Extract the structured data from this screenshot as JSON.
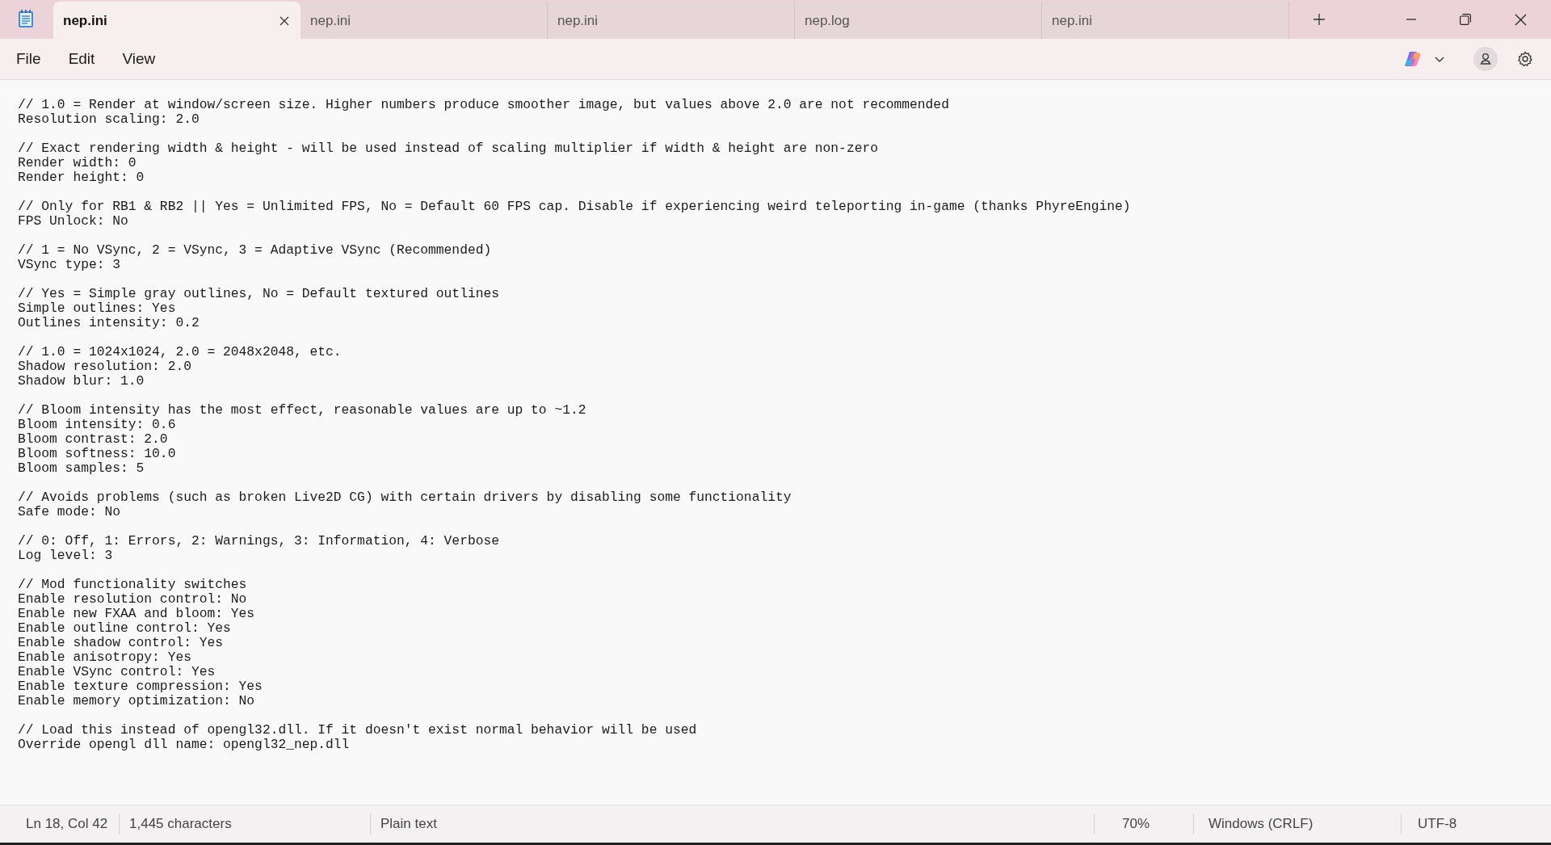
{
  "tabs": [
    {
      "label": "nep.ini",
      "selected": true
    },
    {
      "label": "nep.ini",
      "selected": false
    },
    {
      "label": "nep.ini",
      "selected": false
    },
    {
      "label": "nep.log",
      "selected": false
    },
    {
      "label": "nep.ini",
      "selected": false
    }
  ],
  "menu": [
    "File",
    "Edit",
    "View"
  ],
  "editor": {
    "blocks": [
      [
        "// 1.0 = Render at window/screen size. Higher numbers produce smoother image, but values above 2.0 are not recommended",
        "Resolution scaling: 2.0"
      ],
      [
        "// Exact rendering width & height - will be used instead of scaling multiplier if width & height are non-zero",
        "Render width: 0",
        "Render height: 0"
      ],
      [
        "// Only for RB1 & RB2 || Yes = Unlimited FPS, No = Default 60 FPS cap. Disable if experiencing weird teleporting in-game (thanks PhyreEngine)",
        "FPS Unlock: No"
      ],
      [
        "// 1 = No VSync, 2 = VSync, 3 = Adaptive VSync (Recommended)",
        "VSync type: 3"
      ],
      [
        "// Yes = Simple gray outlines, No = Default textured outlines",
        "Simple outlines: Yes",
        "Outlines intensity: 0.2"
      ],
      [
        "// 1.0 = 1024x1024, 2.0 = 2048x2048, etc.",
        "Shadow resolution: 2.0",
        "Shadow blur: 1.0"
      ],
      [
        "// Bloom intensity has the most effect, reasonable values are up to ~1.2",
        "Bloom intensity: 0.6",
        "Bloom contrast: 2.0",
        "Bloom softness: 10.0",
        "Bloom samples: 5"
      ],
      [
        "// Avoids problems (such as broken Live2D CG) with certain drivers by disabling some functionality",
        "Safe mode: No"
      ],
      [
        "// 0: Off, 1: Errors, 2: Warnings, 3: Information, 4: Verbose",
        "Log level: 3"
      ],
      [
        "// Mod functionality switches",
        "Enable resolution control: No",
        "Enable new FXAA and bloom: Yes",
        "Enable outline control: Yes",
        "Enable shadow control: Yes",
        "Enable anisotropy: Yes",
        "Enable VSync control: Yes",
        "Enable texture compression: Yes",
        "Enable memory optimization: No"
      ],
      [
        "// Load this instead of opengl32.dll. If it doesn't exist normal behavior will be used",
        "Override opengl dll name: opengl32_nep.dll"
      ]
    ]
  },
  "status_bar": {
    "position": "Ln 18, Col 42",
    "characters": "1,445 characters",
    "format": "Plain text",
    "zoom": "70%",
    "line_endings": "Windows (CRLF)",
    "encoding": "UTF-8"
  }
}
